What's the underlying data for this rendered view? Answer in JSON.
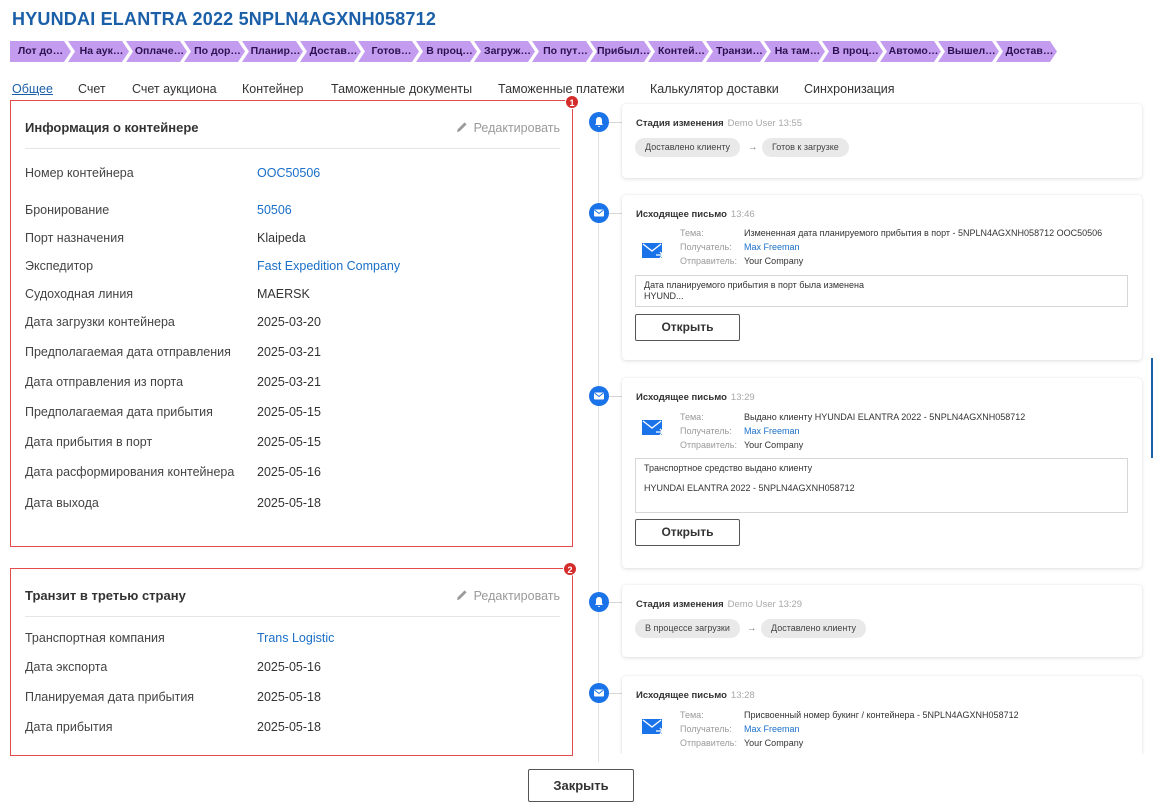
{
  "title": "HYUNDAI ELANTRA 2022 5NPLN4AGXNH058712",
  "stages": [
    "Лот до…",
    "На аук…",
    "Оплаче…",
    "По дор…",
    "Планир…",
    "Достав…",
    "Готов…",
    "В проц…",
    "Загруж…",
    "По пут…",
    "Прибыл…",
    "Контей…",
    "Транзи…",
    "На там…",
    "В проц…",
    "Автомо…",
    "Вышел…",
    "Достав…"
  ],
  "tabs": [
    "Общее",
    "Счет",
    "Счет аукциона",
    "Контейнер",
    "Таможенные документы",
    "Таможенные платежи",
    "Калькулятор доставки",
    "Синхронизация"
  ],
  "container_card": {
    "badge": "1",
    "title": "Информация о контейнере",
    "edit_label": "Редактировать",
    "rows": [
      {
        "label": "Номер контейнера",
        "value": "OOC50506"
      },
      {
        "label": "Бронирование",
        "value": "50506"
      },
      {
        "label": "Порт назначения",
        "value": "Klaipeda"
      },
      {
        "label": "Экспедитор",
        "value": "Fast Expedition Company"
      },
      {
        "label": "Судоходная линия",
        "value": "MAERSK"
      },
      {
        "label": "Дата загрузки контейнера",
        "value": "2025-03-20"
      },
      {
        "label": "Предполагаемая дата отправления",
        "value": "2025-03-21"
      },
      {
        "label": "Дата отправления из порта",
        "value": "2025-03-21"
      },
      {
        "label": "Предполагаемая дата прибытия",
        "value": "2025-05-15"
      },
      {
        "label": "Дата прибытия в порт",
        "value": "2025-05-15"
      },
      {
        "label": "Дата расформирования контейнера",
        "value": "2025-05-16"
      },
      {
        "label": "Дата выхода",
        "value": "2025-05-18"
      }
    ]
  },
  "transit_card": {
    "badge": "2",
    "title": "Транзит в третью страну",
    "edit_label": "Редактировать",
    "rows": [
      {
        "label": "Транспортная компания",
        "value": "Trans Logistic"
      },
      {
        "label": "Дата экспорта",
        "value": "2025-05-16"
      },
      {
        "label": "Планируемая дата прибытия",
        "value": "2025-05-18"
      },
      {
        "label": "Дата прибытия",
        "value": "2025-05-18"
      }
    ]
  },
  "timeline": {
    "ev1": {
      "type": "Стадия изменения",
      "meta": "Demo User 13:55",
      "from": "Доставлено клиенту",
      "arrow": "→",
      "to": "Готов к загрузке"
    },
    "ev2": {
      "type": "Исходящее письмо",
      "meta": "13:46",
      "subject_key": "Тема:",
      "subject": "Измененная дата планируемого прибытия в порт - 5NPLN4AGXNH058712 OOC50506",
      "recipient_key": "Получатель:",
      "recipient": "Max Freeman",
      "sender_key": "Отправитель:",
      "sender": "Your Company",
      "body_line1": "Дата планируемого прибытия в порт была изменена",
      "body_line2": "HYUND...",
      "open_label": "Открыть"
    },
    "ev3": {
      "type": "Исходящее письмо",
      "meta": "13:29",
      "subject_key": "Тема:",
      "subject": "Выдано клиенту HYUNDAI ELANTRA 2022 - 5NPLN4AGXNH058712",
      "recipient_key": "Получатель:",
      "recipient": "Max Freeman",
      "sender_key": "Отправитель:",
      "sender": "Your Company",
      "body_line1": "Транспортное средство выдано клиенту",
      "body_line2": "HYUNDAI ELANTRA 2022 - 5NPLN4AGXNH058712",
      "open_label": "Открыть"
    },
    "ev4": {
      "type": "Стадия изменения",
      "meta": "Demo User 13:29",
      "from": "В процессе загрузки",
      "arrow": "→",
      "to": "Доставлено клиенту"
    },
    "ev5": {
      "type": "Исходящее письмо",
      "meta": "13:28",
      "subject_key": "Тема:",
      "subject": "Присвоенный номер букинг / контейнера - 5NPLN4AGXNH058712",
      "recipient_key": "Получатель:",
      "recipient": "Max Freeman",
      "sender_key": "Отправитель:",
      "sender": "Your Company"
    }
  },
  "close_label": "Закрыть",
  "colors": {
    "accent": "#1a5fa8",
    "stage": "#c39cf0",
    "link": "#1a6fc8",
    "highlight": "#e24b4b",
    "timeline_icon": "#1a73e8"
  }
}
